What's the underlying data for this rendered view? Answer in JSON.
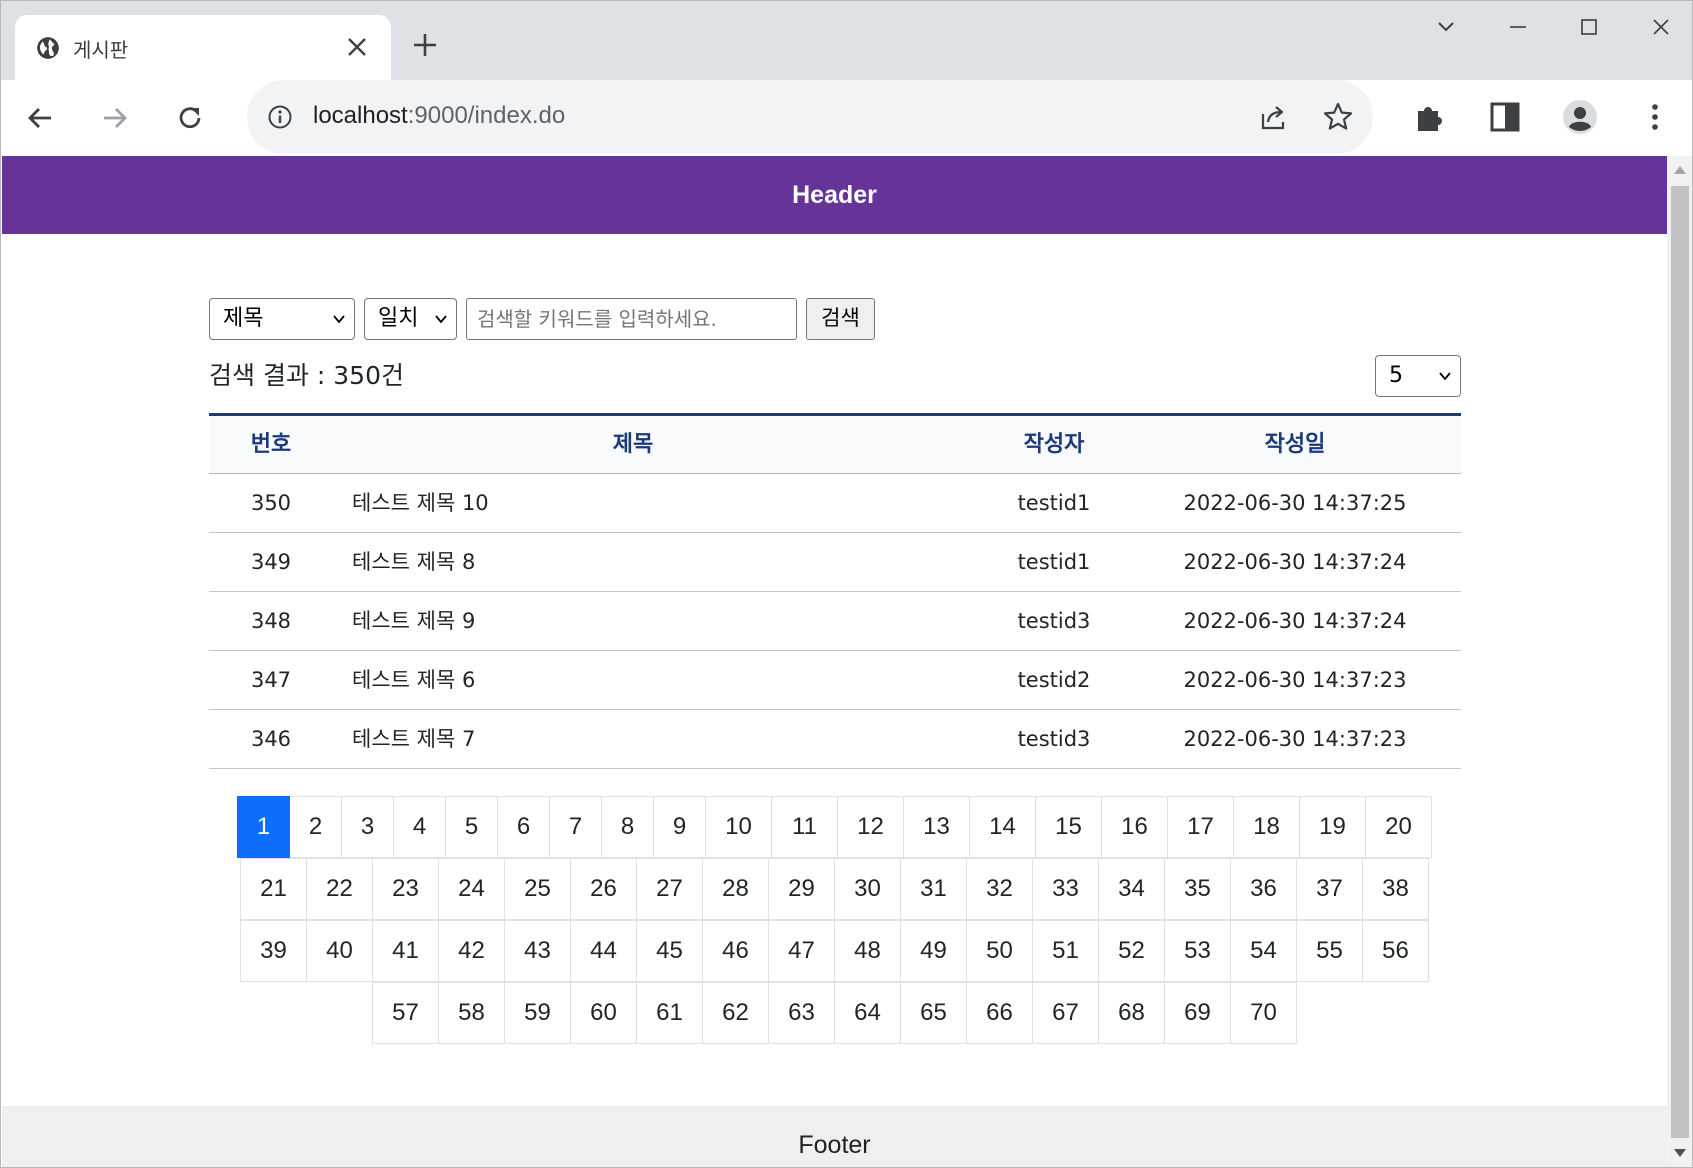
{
  "browser": {
    "tab_title": "게시판",
    "url_host": "localhost",
    "url_rest": ":9000/index.do"
  },
  "page": {
    "header": "Header",
    "footer": "Footer"
  },
  "search": {
    "field_selected": "제목",
    "match_selected": "일치",
    "keyword_placeholder": "검색할 키워드를 입력하세요.",
    "submit_label": "검색",
    "result_text": "검색 결과 : 350건",
    "page_size_selected": "5"
  },
  "table": {
    "headers": [
      "번호",
      "제목",
      "작성자",
      "작성일"
    ],
    "rows": [
      {
        "no": "350",
        "title": "테스트 제목 10",
        "writer": "testid1",
        "date": "2022-06-30 14:37:25"
      },
      {
        "no": "349",
        "title": "테스트 제목 8",
        "writer": "testid1",
        "date": "2022-06-30 14:37:24"
      },
      {
        "no": "348",
        "title": "테스트 제목 9",
        "writer": "testid3",
        "date": "2022-06-30 14:37:24"
      },
      {
        "no": "347",
        "title": "테스트 제목 6",
        "writer": "testid2",
        "date": "2022-06-30 14:37:23"
      },
      {
        "no": "346",
        "title": "테스트 제목 7",
        "writer": "testid3",
        "date": "2022-06-30 14:37:23"
      }
    ]
  },
  "pagination": {
    "current": "1",
    "rows": [
      [
        "1",
        "2",
        "3",
        "4",
        "5",
        "6",
        "7",
        "8",
        "9",
        "10",
        "11",
        "12",
        "13",
        "14",
        "15",
        "16",
        "17",
        "18",
        "19",
        "20"
      ],
      [
        "21",
        "22",
        "23",
        "24",
        "25",
        "26",
        "27",
        "28",
        "29",
        "30",
        "31",
        "32",
        "33",
        "34",
        "35",
        "36",
        "37",
        "38"
      ],
      [
        "39",
        "40",
        "41",
        "42",
        "43",
        "44",
        "45",
        "46",
        "47",
        "48",
        "49",
        "50",
        "51",
        "52",
        "53",
        "54",
        "55",
        "56"
      ],
      [
        "57",
        "58",
        "59",
        "60",
        "61",
        "62",
        "63",
        "64",
        "65",
        "66",
        "67",
        "68",
        "69",
        "70"
      ]
    ]
  },
  "colors": {
    "header_bg": "#663399",
    "table_accent": "#1a3a7a",
    "active_page": "#0d6efd"
  }
}
